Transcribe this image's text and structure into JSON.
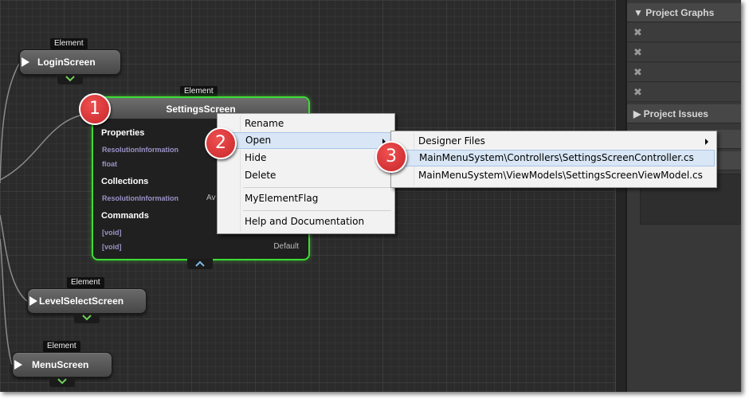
{
  "nodes": {
    "element_tag": "Element",
    "login": "LoginScreen",
    "levelselect": "LevelSelectScreen",
    "menu": "MenuScreen",
    "settings": {
      "title": "SettingsScreen",
      "properties_label": "Properties",
      "prop_1": "ResolutionInformation",
      "prop_2": "float",
      "collections_label": "Collections",
      "coll_1": "ResolutionInformation",
      "coll_1_right": "Av",
      "commands_label": "Commands",
      "cmd_1": "[void]",
      "cmd_2": "[void]",
      "cmd_2_right": "Default"
    }
  },
  "sidebar": {
    "project_graphs": "Project Graphs",
    "project_issues": "Project Issues",
    "graph_rows": [
      "✖",
      "✖",
      "✖",
      "✖"
    ]
  },
  "context_menu": {
    "items": [
      "Rename",
      "Open",
      "Hide",
      "Delete",
      "MyElementFlag",
      "Help and Documentation"
    ]
  },
  "open_submenu": {
    "items": [
      "Designer Files",
      "MainMenuSystem\\Controllers\\SettingsScreenController.cs",
      "MainMenuSystem\\ViewModels\\SettingsScreenViewModel.cs"
    ]
  },
  "callouts": [
    "1",
    "2",
    "3"
  ],
  "colors": {
    "selected_border": "#3ddc35",
    "callout": "#d63a3a",
    "menu_highlight": "#d8e6f5"
  }
}
